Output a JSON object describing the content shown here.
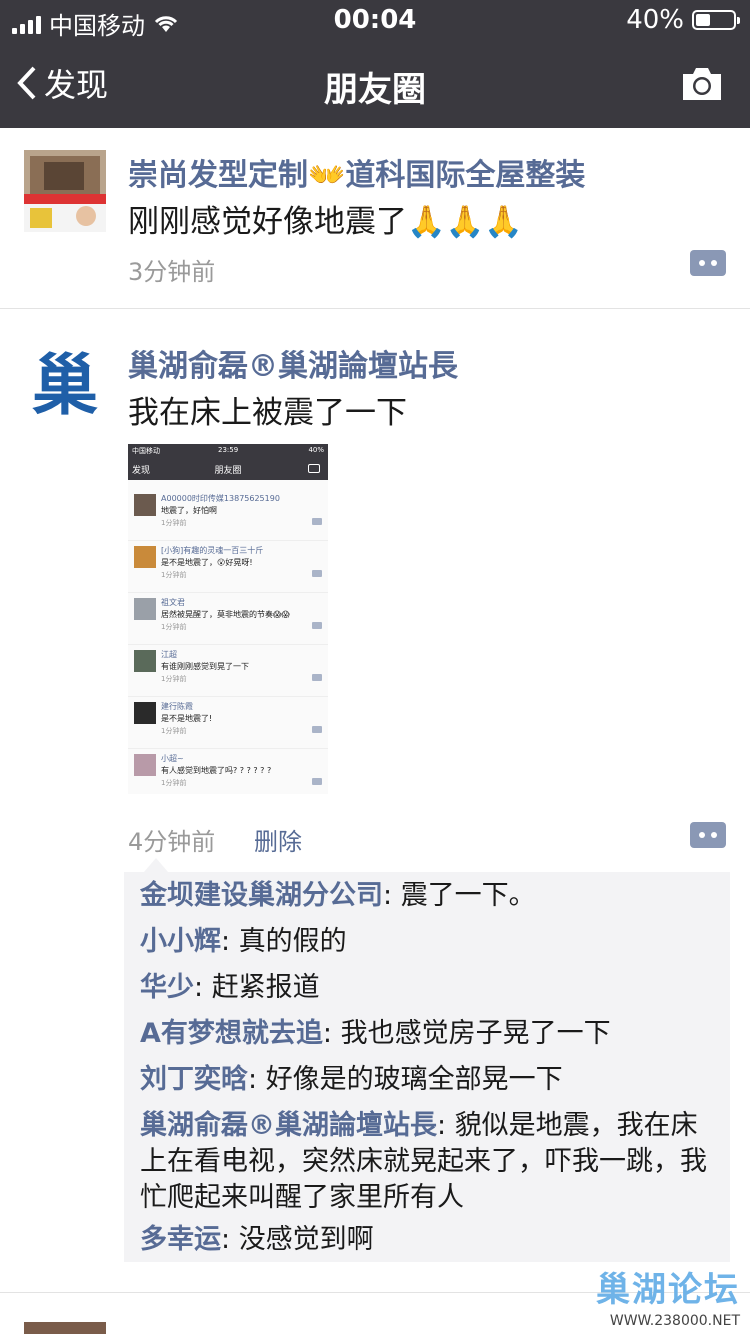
{
  "status_bar": {
    "carrier": "中国移动",
    "time": "00:04",
    "battery": "40%",
    "battery_level": 0.4
  },
  "nav": {
    "back_label": "发现",
    "title": "朋友圈",
    "camera_icon": "camera-icon"
  },
  "posts": [
    {
      "name": "崇尚发型定制👐道科国际全屋整装",
      "text": "刚刚感觉好像地震了🙏🙏🙏",
      "time": "3分钟前"
    },
    {
      "name": "巢湖俞磊®巢湖論壇站長",
      "text": "我在床上被震了一下",
      "time": "4分钟前",
      "delete_label": "删除",
      "avatar_glyph": "巢",
      "embedded_screenshot": {
        "carrier": "中国移动",
        "time": "23:59",
        "battery": "40%",
        "back": "发现",
        "title": "朋友圈",
        "items": [
          {
            "name": "A00000时印传媒13875625190",
            "text": "地震了，好怕啊",
            "time": "1分钟前"
          },
          {
            "name": "[小狗]有趣的灵魂一百三十斤",
            "text": "是不是地震了，😮好晃呀!",
            "time": "1分钟前"
          },
          {
            "name": "祖文君",
            "text": "居然被晃醒了，莫非地震的节奏😱😱",
            "time": "1分钟前"
          },
          {
            "name": "江超",
            "text": "有谁刚刚感觉到晃了一下",
            "time": "1分钟前"
          },
          {
            "name": "建行陈霞",
            "text": "是不是地震了!",
            "time": "1分钟前"
          },
          {
            "name": "小超~",
            "text": "有人感觉到地震了吗? ? ? ? ? ?",
            "time": "1分钟前"
          }
        ]
      },
      "comments": [
        {
          "author": "金坝建设巢湖分公司",
          "text": "震了一下。"
        },
        {
          "author": "小小辉",
          "text": "真的假的"
        },
        {
          "author": "华少",
          "text": "赶紧报道"
        },
        {
          "author": "A有梦想就去追",
          "text": "我也感觉房子晃了一下"
        },
        {
          "author": "刘丁奕晗",
          "text": "好像是的玻璃全部晃一下"
        },
        {
          "author": "巢湖俞磊®巢湖論壇站長",
          "text": "貌似是地震，我在床上在看电视，突然床就晃起来了，吓我一跳，我忙爬起来叫醒了家里所有人"
        },
        {
          "author": "多幸运",
          "text": "没感觉到啊"
        }
      ]
    }
  ],
  "watermark": {
    "title": "巢湖论坛",
    "url": "WWW.238000.NET"
  },
  "colors": {
    "bar": "#3a393f",
    "link": "#576b95",
    "comment_bg": "#f3f3f5"
  }
}
